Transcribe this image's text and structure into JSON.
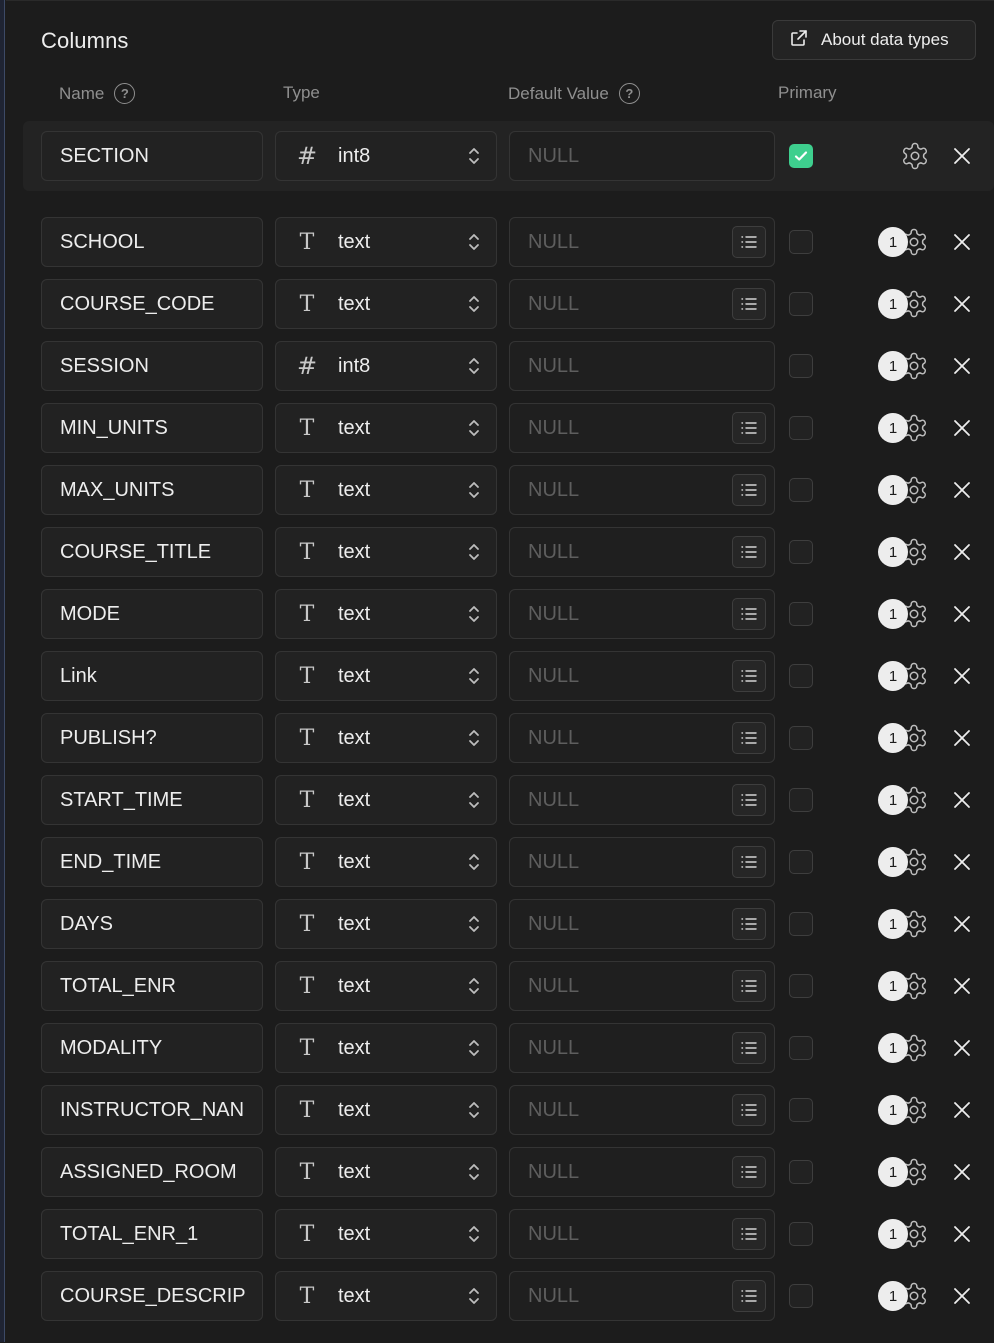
{
  "section": {
    "title": "Columns",
    "about_label": "About data types"
  },
  "headers": {
    "name": "Name",
    "type": "Type",
    "default_value": "Default Value",
    "primary": "Primary",
    "help_glyph": "?"
  },
  "placeholder": "NULL",
  "badge_count": "1",
  "colors": {
    "accent": "#3ecf8e",
    "background": "#1c1c1c"
  },
  "icons": {
    "integer_type": "hash-icon",
    "text_type": "text-type-icon",
    "gear": "gear-icon",
    "remove": "close-icon",
    "list": "list-icon",
    "external": "external-link-icon"
  },
  "rows": [
    {
      "name": "SECTION",
      "type": "int8",
      "kind": "int",
      "primary": true
    },
    {
      "name": "SCHOOL",
      "type": "text",
      "kind": "text",
      "primary": false
    },
    {
      "name": "COURSE_CODE",
      "type": "text",
      "kind": "text",
      "primary": false
    },
    {
      "name": "SESSION",
      "type": "int8",
      "kind": "int",
      "primary": false
    },
    {
      "name": "MIN_UNITS",
      "type": "text",
      "kind": "text",
      "primary": false
    },
    {
      "name": "MAX_UNITS",
      "type": "text",
      "kind": "text",
      "primary": false
    },
    {
      "name": "COURSE_TITLE",
      "type": "text",
      "kind": "text",
      "primary": false
    },
    {
      "name": "MODE",
      "type": "text",
      "kind": "text",
      "primary": false
    },
    {
      "name": "Link",
      "type": "text",
      "kind": "text",
      "primary": false
    },
    {
      "name": "PUBLISH?",
      "type": "text",
      "kind": "text",
      "primary": false
    },
    {
      "name": "START_TIME",
      "type": "text",
      "kind": "text",
      "primary": false
    },
    {
      "name": "END_TIME",
      "type": "text",
      "kind": "text",
      "primary": false
    },
    {
      "name": "DAYS",
      "type": "text",
      "kind": "text",
      "primary": false
    },
    {
      "name": "TOTAL_ENR",
      "type": "text",
      "kind": "text",
      "primary": false
    },
    {
      "name": "MODALITY",
      "type": "text",
      "kind": "text",
      "primary": false
    },
    {
      "name": "INSTRUCTOR_NAN",
      "type": "text",
      "kind": "text",
      "primary": false
    },
    {
      "name": "ASSIGNED_ROOM",
      "type": "text",
      "kind": "text",
      "primary": false
    },
    {
      "name": "TOTAL_ENR_1",
      "type": "text",
      "kind": "text",
      "primary": false
    },
    {
      "name": "COURSE_DESCRIP",
      "type": "text",
      "kind": "text",
      "primary": false
    }
  ]
}
